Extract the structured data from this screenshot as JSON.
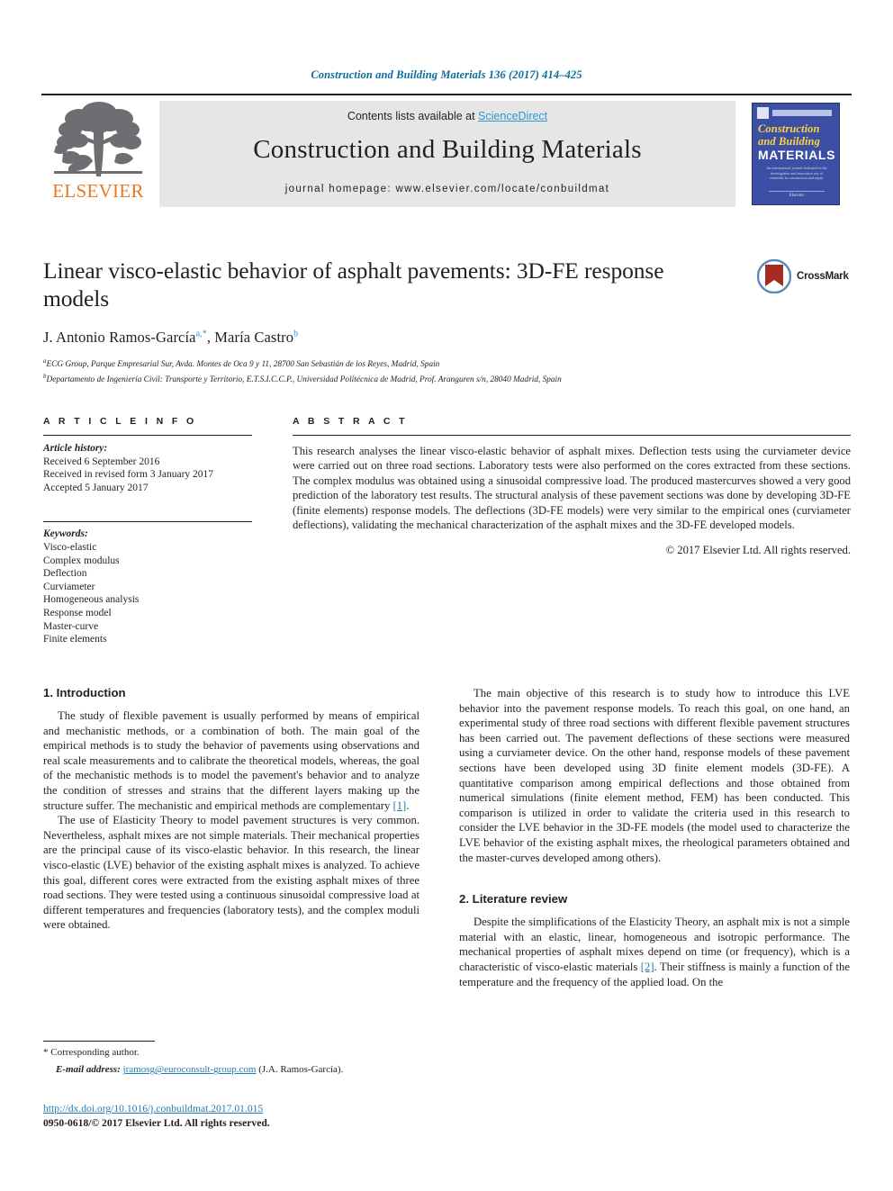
{
  "running_head": "Construction and Building Materials 136 (2017) 414–425",
  "masthead": {
    "contents_prefix": "Contents lists available at ",
    "sciencedirect": "ScienceDirect",
    "journal_title": "Construction and Building Materials",
    "homepage": "journal homepage: www.elsevier.com/locate/conbuildmat",
    "publisher": "ELSEVIER",
    "cover": {
      "line1": "Construction",
      "line2": "and Building",
      "line3": "MATERIALS",
      "blurb": "An international journal dedicated to the investigation and innovative use of materials in construction and repair",
      "foot": "Elsevier"
    }
  },
  "article": {
    "title": "Linear visco-elastic behavior of asphalt pavements: 3D-FE response models",
    "authors": [
      {
        "name": "J. Antonio Ramos-García",
        "marks": "a,*"
      },
      {
        "name": "María Castro",
        "marks": "b"
      }
    ],
    "affiliations": [
      {
        "mark": "a",
        "text": "ECG Group, Parque Empresarial Sur, Avda. Montes de Oca 9 y 11, 28700 San Sebastián de los Reyes, Madrid, Spain"
      },
      {
        "mark": "b",
        "text": "Departamento de Ingeniería Civil: Transporte y Territorio, E.T.S.I.C.C.P., Universidad Politécnica de Madrid, Prof. Aranguren s/n, 28040 Madrid, Spain"
      }
    ],
    "crossmark_label": "CrossMark"
  },
  "article_info": {
    "heading": "A R T I C L E   I N F O",
    "history_title": "Article history:",
    "history": [
      "Received 6 September 2016",
      "Received in revised form 3 January 2017",
      "Accepted 5 January 2017"
    ],
    "keywords_title": "Keywords:",
    "keywords": [
      "Visco-elastic",
      "Complex modulus",
      "Deflection",
      "Curviameter",
      "Homogeneous analysis",
      "Response model",
      "Master-curve",
      "Finite elements"
    ]
  },
  "abstract": {
    "heading": "A B S T R A C T",
    "text": "This research analyses the linear visco-elastic behavior of asphalt mixes. Deflection tests using the curviameter device were carried out on three road sections. Laboratory tests were also performed on the cores extracted from these sections. The complex modulus was obtained using a sinusoidal compressive load. The produced mastercurves showed a very good prediction of the laboratory test results. The structural analysis of these pavement sections was done by developing 3D-FE (finite elements) response models. The deflections (3D-FE models) were very similar to the empirical ones (curviameter deflections), validating the mechanical characterization of the asphalt mixes and the 3D-FE developed models.",
    "copyright": "© 2017 Elsevier Ltd. All rights reserved."
  },
  "body": {
    "section1_heading": "1. Introduction",
    "section1_p1_a": "The study of flexible pavement is usually performed by means of empirical and mechanistic methods, or a combination of both. The main goal of the empirical methods is to study the behavior of pavements using observations and real scale measurements and to calibrate the theoretical models, whereas, the goal of the mechanistic methods is to model the pavement's behavior and to analyze the condition of stresses and strains that the different layers making up the structure suffer. The mechanistic and empirical methods are complementary ",
    "section1_p1_cite": "[1]",
    "section1_p1_b": ".",
    "section1_p2": "The use of Elasticity Theory to model pavement structures is very common. Nevertheless, asphalt mixes are not simple materials. Their mechanical properties are the principal cause of its visco-elastic behavior. In this research, the linear visco-elastic (LVE) behavior of the existing asphalt mixes is analyzed. To achieve this goal, different cores were extracted from the existing asphalt mixes of three road sections. They were tested using a continuous sinusoidal compressive load at different temperatures and frequencies (laboratory tests), and the complex moduli were obtained.",
    "right_p1": "The main objective of this research is to study how to introduce this LVE behavior into the pavement response models. To reach this goal, on one hand, an experimental study of three road sections with different flexible pavement structures has been carried out. The pavement deflections of these sections were measured using a curviameter device. On the other hand, response models of these pavement sections have been developed using 3D finite element models (3D-FE). A quantitative comparison among empirical deflections and those obtained from numerical simulations (finite element method, FEM) has been conducted. This comparison is utilized in order to validate the criteria used in this research to consider the LVE behavior in the 3D-FE models (the model used to characterize the LVE behavior of the existing asphalt mixes, the rheological parameters obtained and the master-curves developed among others).",
    "section2_heading": "2. Literature review",
    "section2_p1_a": "Despite the simplifications of the Elasticity Theory, an asphalt mix is not a simple material with an elastic, linear, homogeneous and isotropic performance. The mechanical properties of asphalt mixes depend on time (or frequency), which is a characteristic of visco-elastic materials ",
    "section2_p1_cite": "[2]",
    "section2_p1_b": ". Their stiffness is mainly a function of the temperature and the frequency of the applied load. On the"
  },
  "footer": {
    "corresponding": "* Corresponding author.",
    "email_label": "E-mail address:",
    "email": "jramosg@euroconsult-group.com",
    "email_owner": "(J.A. Ramos-García).",
    "doi": "http://dx.doi.org/10.1016/j.conbuildmat.2017.01.015",
    "issn": "0950-0618/© 2017 Elsevier Ltd. All rights reserved."
  },
  "colors": {
    "link": "#1f7bb6",
    "sciencedirect": "#2b99d4",
    "elsevier_orange": "#e87722",
    "running_head": "#0b6d9e",
    "cover_blue": "#3b4fa4",
    "cover_yellow": "#ffd23a"
  }
}
